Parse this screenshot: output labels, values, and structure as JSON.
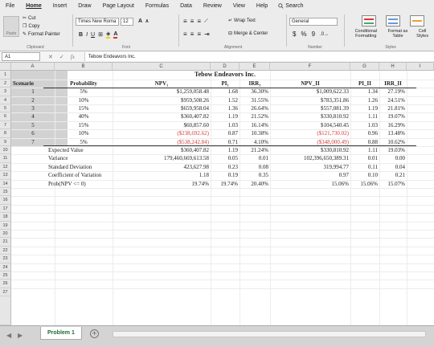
{
  "menu": {
    "items": [
      "File",
      "Home",
      "Insert",
      "Draw",
      "Page Layout",
      "Formulas",
      "Data",
      "Review",
      "View",
      "Help"
    ],
    "active": "Home",
    "search_label": "Search"
  },
  "ribbon": {
    "clipboard": {
      "paste": "Paste",
      "cut": "Cut",
      "copy": "Copy",
      "format_painter": "Format Painter",
      "group": "Clipboard"
    },
    "font": {
      "name": "Times New Roma",
      "size": "12",
      "bold": "B",
      "italic": "I",
      "underline": "U",
      "grow": "A",
      "shrink": "A",
      "color": "A",
      "group": "Font"
    },
    "alignment": {
      "wrap": "Wrap Text",
      "merge": "Merge & Center",
      "group": "Alignment"
    },
    "number": {
      "format": "General",
      "currency": "$",
      "percent": "%",
      "comma": "9",
      "group": "Number"
    },
    "styles": {
      "conditional": "Conditional Formatting",
      "format_as": "Format as Table",
      "cell": "Cell Styles",
      "group": "Styles"
    }
  },
  "formula_bar": {
    "cell_ref": "A1",
    "cancel": "✕",
    "enter": "✓",
    "fx": "fx",
    "content": "Tebow Endeavors Inc."
  },
  "grid": {
    "columns": [
      "A",
      "B",
      "C",
      "D",
      "E",
      "F",
      "G",
      "H",
      "I"
    ],
    "rows": [
      "1",
      "2",
      "3",
      "4",
      "5",
      "6",
      "7",
      "8",
      "9",
      "10",
      "11",
      "12",
      "13",
      "14",
      "15",
      "16",
      "17",
      "18",
      "19",
      "20",
      "21",
      "22",
      "23",
      "24",
      "25",
      "26",
      "27"
    ],
    "title": "Tebow Endeavors Inc.",
    "headers": {
      "scenario": "Scenario",
      "probability": "Probability",
      "npv1": "NPV₁",
      "pi1": "PI₁",
      "irr1": "IRR₁",
      "npv2": "NPV_II",
      "pi2": "PI_II",
      "irr2": "IRR_II"
    },
    "scenarios": [
      {
        "id": "1",
        "prob": "5%",
        "npv1": "$1,259,058.48",
        "pi1": "1.68",
        "irr1": "36.30%",
        "npv2": "$1,009,622.33",
        "pi2": "1.34",
        "irr2": "27.19%"
      },
      {
        "id": "2",
        "prob": "10%",
        "npv1": "$959,508.26",
        "pi1": "1.52",
        "irr1": "31.55%",
        "npv2": "$783,351.86",
        "pi2": "1.26",
        "irr2": "24.51%"
      },
      {
        "id": "3",
        "prob": "15%",
        "npv1": "$659,958.04",
        "pi1": "1.36",
        "irr1": "26.64%",
        "npv2": "$557,081.39",
        "pi2": "1.19",
        "irr2": "21.81%"
      },
      {
        "id": "4",
        "prob": "40%",
        "npv1": "$360,407.82",
        "pi1": "1.19",
        "irr1": "21.52%",
        "npv2": "$330,810.92",
        "pi2": "1.11",
        "irr2": "19.07%"
      },
      {
        "id": "5",
        "prob": "15%",
        "npv1": "$60,857.60",
        "pi1": "1.03",
        "irr1": "16.14%",
        "npv2": "$104,540.45",
        "pi2": "1.03",
        "irr2": "16.29%"
      },
      {
        "id": "6",
        "prob": "10%",
        "npv1": "($238,692.62)",
        "pi1": "0.87",
        "irr1": "10.38%",
        "npv2": "($121,730.02)",
        "pi2": "0.96",
        "irr2": "13.48%",
        "neg1": true,
        "neg2": true
      },
      {
        "id": "7",
        "prob": "5%",
        "npv1": "($538,242.84)",
        "pi1": "0.71",
        "irr1": "4.10%",
        "npv2": "($348,000.49)",
        "pi2": "0.88",
        "irr2": "10.62%",
        "neg1": true,
        "neg2": true
      }
    ],
    "stats": [
      {
        "label": "Expected Value",
        "npv1": "$360,407.82",
        "pi1": "1.19",
        "irr1": "21.24%",
        "npv2": "$330,810.92",
        "pi2": "1.11",
        "irr2": "19.03%"
      },
      {
        "label": "Variance",
        "npv1": "179,460,669,613.58",
        "pi1": "0.05",
        "irr1": "0.01",
        "npv2": "102,396,650,389.31",
        "pi2": "0.01",
        "irr2": "0.00"
      },
      {
        "label": "Standard Deviation",
        "npv1": "423,627.98",
        "pi1": "0.23",
        "irr1": "0.08",
        "npv2": "319,994.77",
        "pi2": "0.11",
        "irr2": "0.04"
      },
      {
        "label": "Coefficient of Variation",
        "npv1": "1.18",
        "pi1": "0.19",
        "irr1": "0.35",
        "npv2": "0.97",
        "pi2": "0.10",
        "irr2": "0.21"
      },
      {
        "label": "Prob(NPV <= 0)",
        "npv1": "19.74%",
        "pi1": "19.74%",
        "irr1": "20.40%",
        "npv2": "15.06%",
        "pi2": "15.06%",
        "irr2": "15.07%"
      }
    ]
  },
  "sheet_tabs": {
    "active": "Problem 1",
    "add": "+"
  },
  "colors": {
    "negative": "#d43a3a",
    "tab_text": "#1d6b33",
    "header_bg": "#e6e6e6"
  }
}
